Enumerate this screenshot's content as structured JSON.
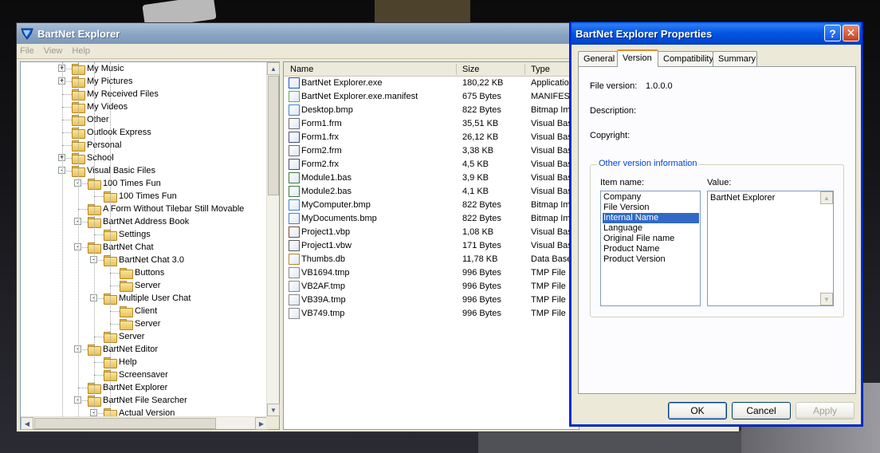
{
  "main_window": {
    "title": "BartNet Explorer",
    "menu": [
      "File",
      "View",
      "Help"
    ]
  },
  "tree": [
    {
      "label": "My Music",
      "indent": 0,
      "expander": "+",
      "icon": "music-folder-icon"
    },
    {
      "label": "My Pictures",
      "indent": 0,
      "expander": "+",
      "icon": "pictures-folder-icon"
    },
    {
      "label": "My Received Files",
      "indent": 0,
      "expander": "",
      "icon": "folder-icon"
    },
    {
      "label": "My Videos",
      "indent": 0,
      "expander": "",
      "icon": "video-folder-icon"
    },
    {
      "label": "Other",
      "indent": 0,
      "expander": "",
      "icon": "folder-icon"
    },
    {
      "label": "Outlook Express",
      "indent": 0,
      "expander": "",
      "icon": "folder-icon"
    },
    {
      "label": "Personal",
      "indent": 0,
      "expander": "",
      "icon": "folder-icon"
    },
    {
      "label": "School",
      "indent": 0,
      "expander": "+",
      "icon": "folder-icon"
    },
    {
      "label": "Visual Basic Files",
      "indent": 0,
      "expander": "-",
      "icon": "folder-icon"
    },
    {
      "label": "100 Times Fun",
      "indent": 1,
      "expander": "-",
      "icon": "folder-icon"
    },
    {
      "label": "100 Times Fun",
      "indent": 2,
      "expander": "",
      "icon": "folder-icon"
    },
    {
      "label": "A Form Without Tilebar Still Movable",
      "indent": 1,
      "expander": "",
      "icon": "folder-icon"
    },
    {
      "label": "BartNet Address Book",
      "indent": 1,
      "expander": "-",
      "icon": "folder-icon"
    },
    {
      "label": "Settings",
      "indent": 2,
      "expander": "",
      "icon": "folder-icon"
    },
    {
      "label": "BartNet Chat",
      "indent": 1,
      "expander": "-",
      "icon": "folder-icon"
    },
    {
      "label": "BartNet Chat 3.0",
      "indent": 2,
      "expander": "-",
      "icon": "folder-icon"
    },
    {
      "label": "Buttons",
      "indent": 3,
      "expander": "",
      "icon": "folder-icon"
    },
    {
      "label": "Server",
      "indent": 3,
      "expander": "",
      "icon": "folder-icon"
    },
    {
      "label": "Multiple User Chat",
      "indent": 2,
      "expander": "-",
      "icon": "folder-icon"
    },
    {
      "label": "Client",
      "indent": 3,
      "expander": "",
      "icon": "folder-icon"
    },
    {
      "label": "Server",
      "indent": 3,
      "expander": "",
      "icon": "folder-icon"
    },
    {
      "label": "Server",
      "indent": 2,
      "expander": "",
      "icon": "folder-icon"
    },
    {
      "label": "BartNet Editor",
      "indent": 1,
      "expander": "-",
      "icon": "folder-icon"
    },
    {
      "label": "Help",
      "indent": 2,
      "expander": "",
      "icon": "folder-icon"
    },
    {
      "label": "Screensaver",
      "indent": 2,
      "expander": "",
      "icon": "folder-icon"
    },
    {
      "label": "BartNet Explorer",
      "indent": 1,
      "expander": "",
      "icon": "folder-icon"
    },
    {
      "label": "BartNet File Searcher",
      "indent": 1,
      "expander": "-",
      "icon": "folder-icon"
    },
    {
      "label": "Actual Version",
      "indent": 2,
      "expander": "-",
      "icon": "folder-icon"
    }
  ],
  "file_list": {
    "columns": [
      "Name",
      "Size",
      "Type"
    ],
    "rows": [
      {
        "name": "BartNet Explorer.exe",
        "size": "180,22 KB",
        "type": "Application",
        "icon": "app-icon"
      },
      {
        "name": "BartNet Explorer.exe.manifest",
        "size": "675 Bytes",
        "type": "MANIFEST",
        "icon": "manifest-file-icon"
      },
      {
        "name": "Desktop.bmp",
        "size": "822 Bytes",
        "type": "Bitmap Ima",
        "icon": "bitmap-file-icon"
      },
      {
        "name": "Form1.frm",
        "size": "35,51 KB",
        "type": "Visual Bas",
        "icon": "vb-form-file-icon"
      },
      {
        "name": "Form1.frx",
        "size": "26,12 KB",
        "type": "Visual Bas",
        "icon": "vb-binary-file-icon"
      },
      {
        "name": "Form2.frm",
        "size": "3,38 KB",
        "type": "Visual Bas",
        "icon": "vb-form-file-icon"
      },
      {
        "name": "Form2.frx",
        "size": "4,5 KB",
        "type": "Visual Bas",
        "icon": "vb-binary-file-icon"
      },
      {
        "name": "Module1.bas",
        "size": "3,9 KB",
        "type": "Visual Bas",
        "icon": "vb-module-file-icon"
      },
      {
        "name": "Module2.bas",
        "size": "4,1 KB",
        "type": "Visual Bas",
        "icon": "vb-module-file-icon"
      },
      {
        "name": "MyComputer.bmp",
        "size": "822 Bytes",
        "type": "Bitmap Ima",
        "icon": "bitmap-file-icon"
      },
      {
        "name": "MyDocuments.bmp",
        "size": "822 Bytes",
        "type": "Bitmap Ima",
        "icon": "bitmap-file-icon"
      },
      {
        "name": "Project1.vbp",
        "size": "1,08 KB",
        "type": "Visual Bas",
        "icon": "vb-project-file-icon"
      },
      {
        "name": "Project1.vbw",
        "size": "171 Bytes",
        "type": "Visual Bas",
        "icon": "vb-workspace-file-icon"
      },
      {
        "name": "Thumbs.db",
        "size": "11,78 KB",
        "type": "Data Base",
        "icon": "database-file-icon"
      },
      {
        "name": "VB1694.tmp",
        "size": "996 Bytes",
        "type": "TMP File",
        "icon": "tmp-file-icon"
      },
      {
        "name": "VB2AF.tmp",
        "size": "996 Bytes",
        "type": "TMP File",
        "icon": "tmp-file-icon"
      },
      {
        "name": "VB39A.tmp",
        "size": "996 Bytes",
        "type": "TMP File",
        "icon": "tmp-file-icon"
      },
      {
        "name": "VB749.tmp",
        "size": "996 Bytes",
        "type": "TMP File",
        "icon": "tmp-file-icon"
      }
    ]
  },
  "properties_dialog": {
    "title": "BartNet Explorer Properties",
    "help_glyph": "?",
    "close_glyph": "✕",
    "tabs": [
      "General",
      "Version",
      "Compatibility",
      "Summary"
    ],
    "active_tab": "Version",
    "file_version_label": "File version:",
    "file_version_value": "1.0.0.0",
    "description_label": "Description:",
    "copyright_label": "Copyright:",
    "group_title": "Other version information",
    "item_name_label": "Item name:",
    "value_label": "Value:",
    "items": [
      "Company",
      "File Version",
      "Internal Name",
      "Language",
      "Original File name",
      "Product Name",
      "Product Version"
    ],
    "selected_item": "Internal Name",
    "value_text": "BartNet Explorer",
    "buttons": {
      "ok": "OK",
      "cancel": "Cancel",
      "apply": "Apply"
    }
  },
  "colors": {
    "selection": "#316ac5",
    "dialog_title": "#0054e3",
    "group_title": "#0046d5"
  }
}
